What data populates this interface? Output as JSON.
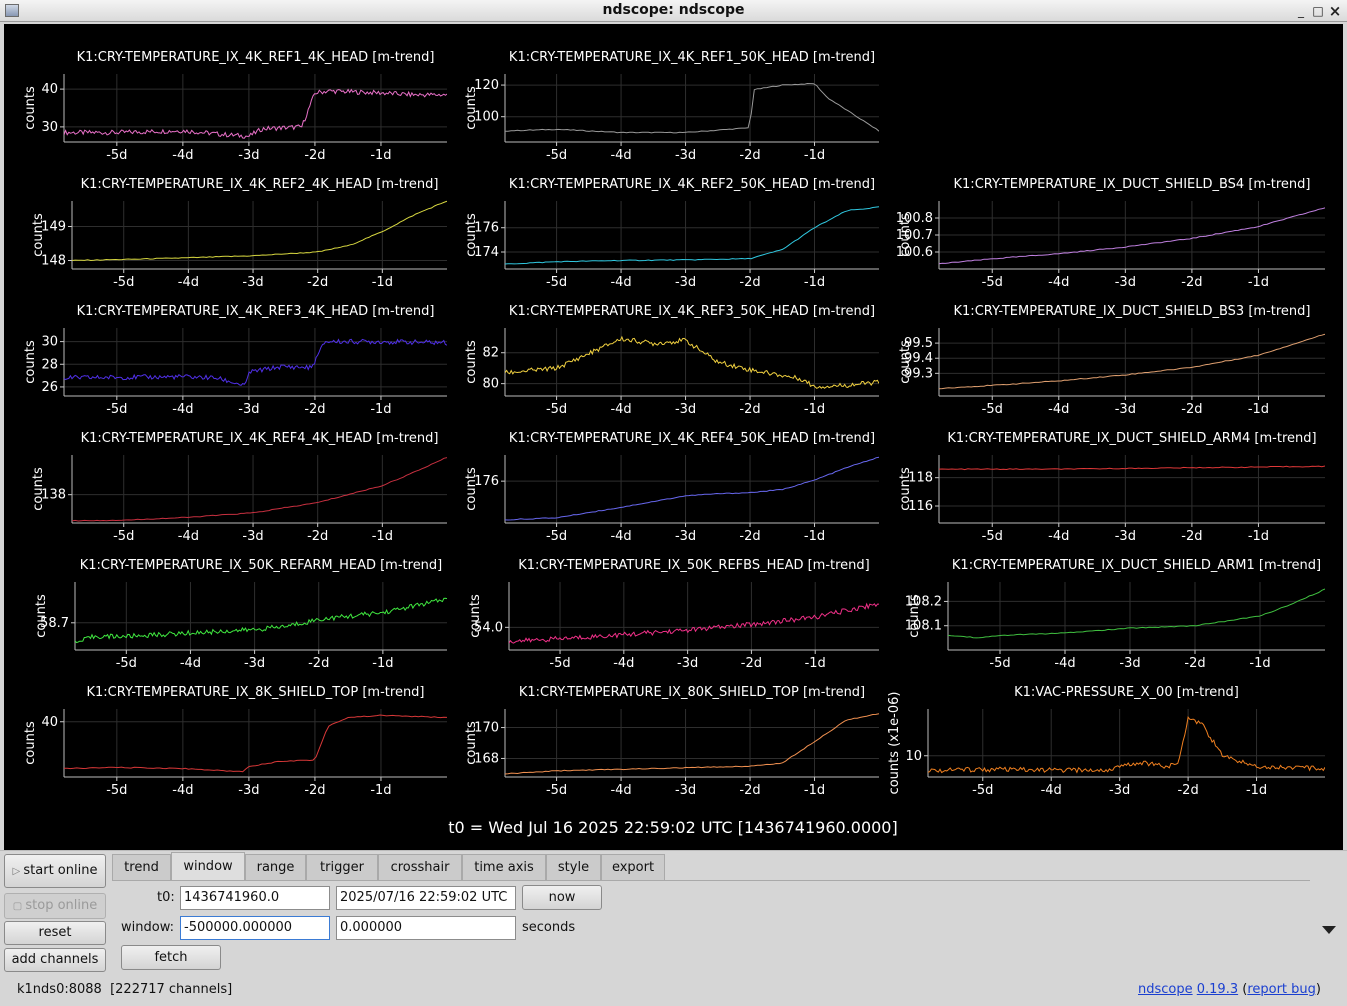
{
  "window": {
    "title": "ndscope: ndscope",
    "minimize": "_",
    "maximize": "□",
    "close": "×"
  },
  "x_ticks": [
    "-5d",
    "-4d",
    "-3d",
    "-2d",
    "-1d"
  ],
  "t0_label": "t0 = Wed Jul 16 2025 22:59:02 UTC [1436741960.0000]",
  "chart_data": [
    {
      "type": "line",
      "title": "K1:CRY-TEMPERATURE_IX_4K_REF1_4K_HEAD [m-trend]",
      "ylabel": "counts",
      "x": [
        "-5d",
        "-4d",
        "-3d",
        "-2d",
        "-1d"
      ],
      "yticks": [
        "30",
        "40"
      ],
      "ylim": [
        26,
        44
      ],
      "color": "#e870c8",
      "series": [
        {
          "x": [
            -5.8,
            -5.0,
            -4.0,
            -3.4,
            -3.0,
            -2.8,
            -2.2,
            -2.0,
            -1.8,
            -1.0,
            -0.5,
            0.0
          ],
          "values": [
            28.5,
            28.5,
            29,
            28,
            27.5,
            29.5,
            30,
            39,
            39.5,
            39,
            38.5,
            38.5
          ]
        }
      ]
    },
    {
      "type": "line",
      "title": "K1:CRY-TEMPERATURE_IX_4K_REF1_50K_HEAD [m-trend]",
      "ylabel": "counts",
      "x": [
        "-5d",
        "-4d",
        "-3d",
        "-2d",
        "-1d"
      ],
      "yticks": [
        "100",
        "120"
      ],
      "ylim": [
        84,
        127
      ],
      "color": "#9a9a9a",
      "series": [
        {
          "x": [
            -5.8,
            -5.0,
            -4.0,
            -3.0,
            -2.0,
            -1.95,
            -1.5,
            -1.0,
            -0.8,
            0.0
          ],
          "values": [
            91,
            92,
            90,
            90,
            93,
            117,
            120,
            121,
            112,
            91
          ]
        }
      ]
    },
    null,
    {
      "type": "line",
      "title": "K1:CRY-TEMPERATURE_IX_4K_REF2_4K_HEAD [m-trend]",
      "ylabel": "counts",
      "x": [
        "-5d",
        "-4d",
        "-3d",
        "-2d",
        "-1d"
      ],
      "yticks": [
        "148",
        "149"
      ],
      "ylim": [
        147.75,
        149.75
      ],
      "color": "#d8d840",
      "series": [
        {
          "x": [
            -5.8,
            -5.0,
            -4.0,
            -3.0,
            -2.0,
            -1.5,
            -1.0,
            -0.5,
            0.0
          ],
          "values": [
            148.0,
            148.03,
            148.08,
            148.14,
            148.25,
            148.45,
            148.85,
            149.35,
            149.75
          ]
        }
      ]
    },
    {
      "type": "line",
      "title": "K1:CRY-TEMPERATURE_IX_4K_REF2_50K_HEAD [m-trend]",
      "ylabel": "counts",
      "x": [
        "-5d",
        "-4d",
        "-3d",
        "-2d",
        "-1d"
      ],
      "yticks": [
        "174",
        "176"
      ],
      "ylim": [
        172.6,
        178.2
      ],
      "color": "#30c8e0",
      "series": [
        {
          "x": [
            -5.8,
            -5.0,
            -4.0,
            -3.0,
            -2.0,
            -1.5,
            -1.0,
            -0.5,
            0.0
          ],
          "values": [
            173.0,
            173.2,
            173.3,
            173.35,
            173.45,
            174.2,
            176.0,
            177.4,
            177.7
          ]
        }
      ]
    },
    {
      "type": "line",
      "title": "K1:CRY-TEMPERATURE_IX_DUCT_SHIELD_BS4 [m-trend]",
      "ylabel": "counts",
      "x": [
        "-5d",
        "-4d",
        "-3d",
        "-2d",
        "-1d"
      ],
      "yticks": [
        "100.6",
        "100.7",
        "100.8"
      ],
      "ylim": [
        100.5,
        100.9
      ],
      "color": "#c080e0",
      "series": [
        {
          "x": [
            -5.8,
            -5.0,
            -4.0,
            -3.0,
            -2.0,
            -1.0,
            0.0
          ],
          "values": [
            100.53,
            100.56,
            100.59,
            100.63,
            100.68,
            100.75,
            100.86
          ]
        }
      ]
    },
    {
      "type": "line",
      "title": "K1:CRY-TEMPERATURE_IX_4K_REF3_4K_HEAD [m-trend]",
      "ylabel": "counts",
      "x": [
        "-5d",
        "-4d",
        "-3d",
        "-2d",
        "-1d"
      ],
      "yticks": [
        "26",
        "28",
        "30"
      ],
      "ylim": [
        25.2,
        31.2
      ],
      "color": "#5030e8",
      "series": [
        {
          "x": [
            -5.8,
            -4.0,
            -3.5,
            -3.05,
            -3.0,
            -2.5,
            -2.05,
            -1.85,
            -1.0,
            0.0
          ],
          "values": [
            26.8,
            26.9,
            26.8,
            26.1,
            27.3,
            27.8,
            27.7,
            30.0,
            30.0,
            29.9
          ]
        }
      ]
    },
    {
      "type": "line",
      "title": "K1:CRY-TEMPERATURE_IX_4K_REF3_50K_HEAD [m-trend]",
      "ylabel": "counts",
      "x": [
        "-5d",
        "-4d",
        "-3d",
        "-2d",
        "-1d"
      ],
      "yticks": [
        "80",
        "82"
      ],
      "ylim": [
        79.2,
        83.6
      ],
      "color": "#f0d040",
      "series": [
        {
          "x": [
            -5.8,
            -5.0,
            -4.0,
            -3.5,
            -3.0,
            -2.5,
            -2.0,
            -1.2,
            -1.0,
            -0.5,
            0.0
          ],
          "values": [
            80.7,
            81.0,
            82.9,
            82.6,
            82.8,
            81.4,
            80.9,
            80.3,
            79.8,
            79.9,
            80.1
          ]
        }
      ]
    },
    {
      "type": "line",
      "title": "K1:CRY-TEMPERATURE_IX_DUCT_SHIELD_BS3 [m-trend]",
      "ylabel": "counts",
      "x": [
        "-5d",
        "-4d",
        "-3d",
        "-2d",
        "-1d"
      ],
      "yticks": [
        "99.3",
        "99.4",
        "99.5"
      ],
      "ylim": [
        99.15,
        99.6
      ],
      "color": "#e0a070",
      "series": [
        {
          "x": [
            -5.8,
            -5.0,
            -4.0,
            -3.0,
            -2.0,
            -1.0,
            0.0
          ],
          "values": [
            99.2,
            99.22,
            99.25,
            99.29,
            99.34,
            99.42,
            99.56
          ]
        }
      ]
    },
    {
      "type": "line",
      "title": "K1:CRY-TEMPERATURE_IX_4K_REF4_4K_HEAD [m-trend]",
      "ylabel": "counts",
      "x": [
        "-5d",
        "-4d",
        "-3d",
        "-2d",
        "-1d"
      ],
      "yticks": [
        "138"
      ],
      "ylim": [
        135.5,
        141.5
      ],
      "color": "#c83040",
      "series": [
        {
          "x": [
            -5.8,
            -5.0,
            -4.0,
            -3.0,
            -2.0,
            -1.0,
            -0.5,
            0.0
          ],
          "values": [
            135.7,
            135.75,
            136.0,
            136.4,
            137.3,
            138.8,
            140.0,
            141.3
          ]
        }
      ]
    },
    {
      "type": "line",
      "title": "K1:CRY-TEMPERATURE_IX_4K_REF4_50K_HEAD [m-trend]",
      "ylabel": "counts",
      "x": [
        "-5d",
        "-4d",
        "-3d",
        "-2d",
        "-1d"
      ],
      "yticks": [
        "176"
      ],
      "ylim": [
        172.0,
        178.5
      ],
      "color": "#6868f0",
      "series": [
        {
          "x": [
            -5.8,
            -5.0,
            -4.0,
            -3.0,
            -2.5,
            -2.0,
            -1.5,
            -1.0,
            -0.5,
            0.0
          ],
          "values": [
            172.3,
            172.5,
            173.5,
            174.6,
            174.8,
            174.9,
            175.2,
            176.1,
            177.3,
            178.3
          ]
        }
      ]
    },
    {
      "type": "line",
      "title": "K1:CRY-TEMPERATURE_IX_DUCT_SHIELD_ARM4 [m-trend]",
      "ylabel": "counts",
      "x": [
        "-5d",
        "-4d",
        "-3d",
        "-2d",
        "-1d"
      ],
      "yticks": [
        "116",
        "118"
      ],
      "ylim": [
        114.8,
        119.6
      ],
      "color": "#e03838",
      "series": [
        {
          "x": [
            -5.8,
            -4.0,
            -2.0,
            0.0
          ],
          "values": [
            118.6,
            118.6,
            118.7,
            118.8
          ]
        }
      ]
    },
    {
      "type": "line",
      "title": "K1:CRY-TEMPERATURE_IX_50K_REFARM_HEAD [m-trend]",
      "ylabel": "counts",
      "x": [
        "-5d",
        "-4d",
        "-3d",
        "-2d",
        "-1d"
      ],
      "yticks": [
        "58.7"
      ],
      "ylim": [
        58.3,
        59.3
      ],
      "color": "#40e840",
      "series": [
        {
          "x": [
            -5.8,
            -5.5,
            -5.0,
            -4.0,
            -3.0,
            -2.5,
            -2.0,
            -1.0,
            -0.5,
            0.0
          ],
          "values": [
            58.4,
            58.5,
            58.5,
            58.55,
            58.6,
            58.65,
            58.75,
            58.85,
            58.95,
            59.05
          ]
        }
      ]
    },
    {
      "type": "line",
      "title": "K1:CRY-TEMPERATURE_IX_50K_REFBS_HEAD [m-trend]",
      "ylabel": "counts",
      "x": [
        "-5d",
        "-4d",
        "-3d",
        "-2d",
        "-1d"
      ],
      "yticks": [
        "54.0"
      ],
      "ylim": [
        53.6,
        54.8
      ],
      "color": "#f03088",
      "series": [
        {
          "x": [
            -5.8,
            -5.0,
            -4.0,
            -3.0,
            -2.0,
            -1.0,
            0.0
          ],
          "values": [
            53.75,
            53.8,
            53.87,
            53.95,
            54.05,
            54.18,
            54.42
          ]
        }
      ]
    },
    {
      "type": "line",
      "title": "K1:CRY-TEMPERATURE_IX_DUCT_SHIELD_ARM1 [m-trend]",
      "ylabel": "counts",
      "x": [
        "-5d",
        "-4d",
        "-3d",
        "-2d",
        "-1d"
      ],
      "yticks": [
        "108.1",
        "108.2"
      ],
      "ylim": [
        108.0,
        108.28
      ],
      "color": "#40c040",
      "series": [
        {
          "x": [
            -5.8,
            -5.3,
            -5.0,
            -4.0,
            -3.0,
            -2.0,
            -1.0,
            -0.5,
            0.0
          ],
          "values": [
            108.06,
            108.05,
            108.06,
            108.07,
            108.09,
            108.1,
            108.14,
            108.19,
            108.25
          ]
        }
      ]
    },
    {
      "type": "line",
      "title": "K1:CRY-TEMPERATURE_IX_8K_SHIELD_TOP [m-trend]",
      "ylabel": "counts",
      "x": [
        "-5d",
        "-4d",
        "-3d",
        "-2d",
        "-1d"
      ],
      "yticks": [
        "40"
      ],
      "ylim": [
        14,
        46
      ],
      "color": "#d83838",
      "series": [
        {
          "x": [
            -5.8,
            -5.0,
            -4.0,
            -3.1,
            -3.0,
            -2.5,
            -2.0,
            -1.8,
            -1.5,
            -1.0,
            0.0
          ],
          "values": [
            18,
            18.5,
            18,
            16.5,
            19,
            21.5,
            22,
            38,
            42,
            43,
            42
          ]
        }
      ]
    },
    {
      "type": "line",
      "title": "K1:CRY-TEMPERATURE_IX_80K_SHIELD_TOP [m-trend]",
      "ylabel": "counts",
      "x": [
        "-5d",
        "-4d",
        "-3d",
        "-2d",
        "-1d"
      ],
      "yticks": [
        "168",
        "170"
      ],
      "ylim": [
        166.8,
        171.2
      ],
      "color": "#f09050",
      "series": [
        {
          "x": [
            -5.8,
            -5.0,
            -4.0,
            -3.0,
            -2.0,
            -1.5,
            -1.0,
            -0.5,
            0.0
          ],
          "values": [
            167.0,
            167.2,
            167.3,
            167.4,
            167.5,
            167.7,
            169.1,
            170.5,
            170.9
          ]
        }
      ]
    },
    {
      "type": "line",
      "title": "K1:VAC-PRESSURE_X_00 [m-trend]",
      "ylabel": "counts (x1e-06)",
      "x": [
        "-5d",
        "-4d",
        "-3d",
        "-2d",
        "-1d"
      ],
      "yticks": [
        "10"
      ],
      "ylim": [
        5,
        21
      ],
      "color": "#f08020",
      "series": [
        {
          "x": [
            -6.0,
            -5.0,
            -4.0,
            -3.2,
            -2.7,
            -2.3,
            -2.15,
            -2.0,
            -1.8,
            -1.5,
            -1.0,
            0.0
          ],
          "values": [
            6.5,
            6.8,
            6.6,
            6.6,
            8.5,
            7.5,
            8.0,
            19.0,
            17.5,
            10,
            7.5,
            7.0
          ]
        }
      ]
    }
  ],
  "controls": {
    "start_online": "start online",
    "stop_online": "stop online",
    "reset": "reset",
    "add_channels": "add channels",
    "tabs": [
      "trend",
      "window",
      "range",
      "trigger",
      "crosshair",
      "time axis",
      "style",
      "export"
    ],
    "active_tab": "window",
    "t0_label": "t0:",
    "t0_gps": "1436741960.0",
    "t0_utc": "2025/07/16 22:59:02 UTC",
    "now": "now",
    "window_label": "window:",
    "window_start": "-500000.000000",
    "window_end": "0.000000",
    "window_units": "seconds",
    "fetch": "fetch"
  },
  "status": {
    "server": "k1nds0:8088",
    "channels": "[222717 channels]",
    "app": "ndscope",
    "version": "0.19.3",
    "report": "report bug"
  }
}
